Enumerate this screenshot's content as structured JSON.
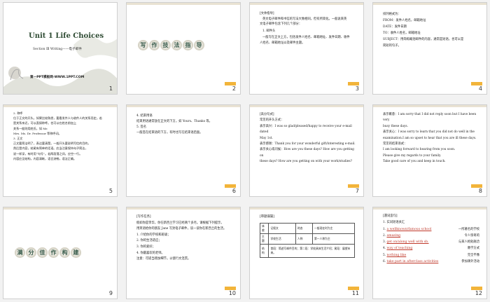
{
  "slides": [
    {
      "num": "1",
      "title": "Unit 1  Life Choices",
      "subtitle": "Section Ⅲ Writing——电子邮件",
      "site": "第一PPT模板网-WWW.1PPT.COM"
    },
    {
      "num": "2",
      "title_chars": [
        "写",
        "作",
        "技",
        "法",
        "指",
        "导"
      ]
    },
    {
      "num": "3",
      "lines": [
        "[文体指导]",
        "英文电子邮件和书信的写法大致相同，但有所简化。一般说来英",
        "文电子邮件包含下列几个部分：",
        "1. 邮件头",
        "一般写在正文上方，包括发件人姓名、邮箱地址、发件日期、收件",
        "人姓名、邮箱地址以及邮件主题。"
      ]
    },
    {
      "num": "4",
      "lines": [
        "排列格式为：",
        "FROM：发件人姓名，邮箱地址",
        "DATE：发件日期",
        "TO：收件人姓名，邮箱地址",
        "SUBJECT：用简练概括邮件的内容，通常是短语，也可以是",
        "简短的句子。"
      ]
    },
    {
      "num": "5",
      "lines": [
        "2. 称呼",
        "位于正文的开头。如果比较熟悉，要看发件人与收件人的关系而定。若",
        "是关系亲近，可以直接称呼。也可以在姓名前加上",
        "关系一般则用姓氏，如 Mr.",
        "Mrs. Ms. Dr. Professor 等称呼词。",
        "3. 正文",
        "正文要简洁明了，表达要清楚。一般开头要说明写信的目的，",
        "然后是内容，结尾有简单的话语。应当注意保持句子简洁，",
        "说一样深，有时用“句号”。若两段落之间，应空一行。",
        "内容应见结构，内容清晰，语言流畅，语法正确。"
      ]
    },
    {
      "num": "6",
      "lines": [
        "4. 结束用语",
        "结束用语通常放在正文的下方，如 Yours、Thanks 等。",
        "",
        "5. 签名",
        "一般签在结束语的下方，有时也写在结束语后面。"
      ]
    },
    {
      "num": "7",
      "lines": [
        "[高分句式]",
        "常见的开头方式：",
        "表示高兴：I was so glad/pleased/happy to receive your e-mail dated",
        "May 1st.",
        "表示感谢：Thank you for your wonderful gift/interesting e-mail.",
        "表示关心或问候：How are you these days? How are you getting on",
        "these days? How are you getting on with your work/studies?"
      ]
    },
    {
      "num": "8",
      "lines": [
        "表示歉意：I am sorry that I did not reply soon but I have been very",
        "busy these days.",
        "表示关心：I was sorry to learn that you did not do well in the",
        "examination.I am so upset to hear that you are ill these days.",
        "常见的结束语式：",
        "I am looking forward to hearing from you soon.",
        "Please give my regards to your family.",
        "Take good care of you and keep in touch."
      ]
    },
    {
      "num": "9",
      "title_chars": [
        "满",
        "分",
        "佳",
        "作",
        "构",
        "建"
      ]
    },
    {
      "num": "10",
      "lines": [
        "[写作任务]",
        "假如你是李华，你在新西兰学习已经两个多月。请根据下列提示，",
        "用英语给你的朋友 Jane 写封电子邮件，谈一谈你在新西兰的生活。",
        "1. 介绍你的学校和班级；",
        "2. 你的生活适应；",
        "3. 你的爱好；",
        "4. 你最喜欢的老师。",
        "注意：可适当增加细节，以使行文连贯。"
      ]
    },
    {
      "num": "11",
      "heading": "[审题谋篇]",
      "rows": [
        [
          "体裁",
          "记叙文",
          "时态",
          "一般现在时为主"
        ],
        [
          "主题",
          "学校生活",
          "人称",
          "第一人称为主"
        ]
      ],
      "structure_label": "结构",
      "structure_text": "首段：简述写邮件目的；第二段：学校具体生活介绍；尾段：展望未来。"
    },
    {
      "num": "12",
      "heading": "[遇词造句]",
      "subheading": "1. 实词短语关汇",
      "items": [
        {
          "en": "a wellknown/famous school",
          "zh": "一所著名的学校"
        },
        {
          "en": "amazing",
          "zh": "令人惊奇的"
        },
        {
          "en": "get on/along well with sb.",
          "zh": "与某人相处融洽"
        },
        {
          "en": "way of teaching",
          "zh": "教学方式"
        },
        {
          "en": "nothing like",
          "zh": "完全不像"
        },
        {
          "en": "take part in afterclass activities",
          "zh": "参加课外活动"
        }
      ]
    }
  ]
}
